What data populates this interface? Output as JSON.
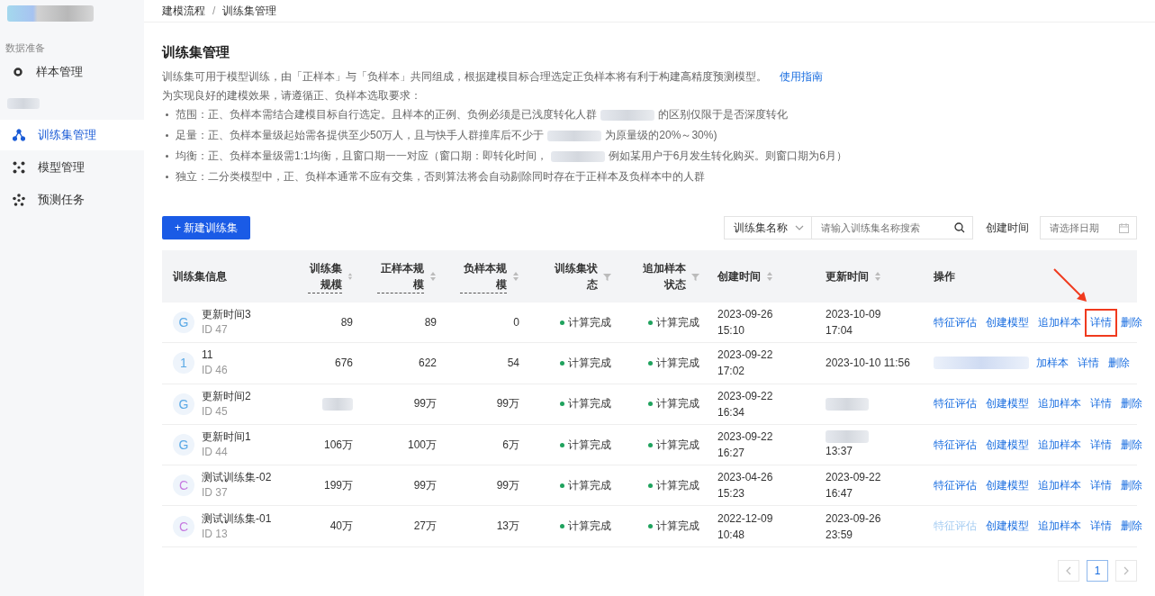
{
  "breadcrumb": {
    "separator": "/",
    "items": [
      "建模流程",
      "训练集管理"
    ]
  },
  "sidebar": {
    "section": "数据准备",
    "items": [
      {
        "label": "样本管理",
        "selected": false
      },
      {
        "kind": "blur"
      },
      {
        "label": "训练集管理",
        "selected": true
      },
      {
        "label": "模型管理",
        "selected": false
      },
      {
        "label": "预测任务",
        "selected": false
      }
    ]
  },
  "page": {
    "title": "训练集管理",
    "intro": "训练集可用于模型训练，由「正样本」与「负样本」共同组成，根据建模目标合理选定正负样本将有利于构建高精度预测模型。",
    "guide_link": "使用指南",
    "requirements_intro": "为实现良好的建模效果，请遵循正、负样本选取要求：",
    "rules": [
      {
        "parts": [
          "范围：正、负样本需结合建模目标自行选定。且样本的正例、负例必须是已浅度转化人群",
          "的区别仅限于是否深度转化"
        ]
      },
      {
        "parts": [
          "足量：正、负样本量级起始需各提供至少50万人，且与快手人群撞库后不少于",
          "为原量级的20%～30%)"
        ]
      },
      {
        "parts": [
          "均衡：正、负样本量级需1:1均衡，且窗口期一一对应（窗口期：即转化时间，",
          "例如某用户于6月发生转化购买。则窗口期为6月）"
        ]
      },
      {
        "parts": [
          "独立：二分类模型中，正、负样本通常不应有交集，否则算法将会自动剔除同时存在于正样本及负样本中的人群"
        ]
      }
    ]
  },
  "toolbar": {
    "create_button": "+ 新建训练集",
    "filter_select": "训练集名称",
    "search_placeholder": "请输入训练集名称搜索",
    "date_label": "创建时间",
    "date_placeholder": "请选择日期"
  },
  "table": {
    "columns": [
      {
        "label": "训练集信息",
        "tip": false
      },
      {
        "label": "训练集规模",
        "tip": true
      },
      {
        "label": "正样本规模",
        "tip": true
      },
      {
        "label": "负样本规模",
        "tip": true
      },
      {
        "label": "训练集状态",
        "tip": false
      },
      {
        "label": "追加样本状态",
        "tip": false
      },
      {
        "label": "创建时间",
        "tip": false
      },
      {
        "label": "更新时间",
        "tip": false
      },
      {
        "label": "操作",
        "tip": false
      }
    ],
    "rows": [
      {
        "avatar": "G",
        "color": "#5aa9e6",
        "name": "更新时间3",
        "id": "ID 47",
        "total": "89",
        "positive": "89",
        "negative": "0",
        "status": "计算完成",
        "append_status": "计算完成",
        "created": {
          "date": "2023-09-26",
          "time": "15:10"
        },
        "updated": {
          "date": "2023-10-09",
          "time": "17:04"
        },
        "actions": [
          {
            "label": "特征评估",
            "disabled": false,
            "highlighted": false
          },
          {
            "label": "创建模型",
            "disabled": false,
            "highlighted": false
          },
          {
            "label": "追加样本",
            "disabled": false,
            "highlighted": false
          },
          {
            "label": "详情",
            "disabled": false,
            "highlighted": true
          },
          {
            "label": "删除",
            "disabled": false,
            "highlighted": false
          }
        ]
      },
      {
        "avatar": "1",
        "color": "#5aa9e6",
        "name": "11",
        "id": "ID 46",
        "total": "676",
        "positive": "622",
        "negative": "54",
        "status": "计算完成",
        "append_status": "计算完成",
        "created": {
          "date": "2023-09-22",
          "time": "17:02"
        },
        "updated": {
          "date": "2023-10-10 11:56"
        },
        "actions": [
          {
            "kind": "blur"
          },
          {
            "label": "加样本",
            "disabled": false,
            "highlighted": false
          },
          {
            "label": "详情",
            "disabled": false,
            "highlighted": false
          },
          {
            "label": "删除",
            "disabled": false,
            "highlighted": false
          }
        ]
      },
      {
        "avatar": "G",
        "color": "#5aa9e6",
        "name": "更新时间2",
        "id": "ID 45",
        "positive": "99万",
        "negative": "99万",
        "status": "计算完成",
        "append_status": "计算完成",
        "created": {
          "date": "2023-09-22",
          "time": "16:34"
        },
        "actions": [
          {
            "label": "特征评估",
            "disabled": false,
            "highlighted": false
          },
          {
            "label": "创建模型",
            "disabled": false,
            "highlighted": false
          },
          {
            "label": "追加样本",
            "disabled": false,
            "highlighted": false
          },
          {
            "label": "详情",
            "disabled": false,
            "highlighted": false
          },
          {
            "label": "删除",
            "disabled": false,
            "highlighted": false
          }
        ]
      },
      {
        "avatar": "G",
        "color": "#5aa9e6",
        "name": "更新时间1",
        "id": "ID 44",
        "total": "106万",
        "positive": "100万",
        "negative": "6万",
        "status": "计算完成",
        "append_status": "计算完成",
        "created": {
          "date": "2023-09-22",
          "time": "16:27"
        },
        "updated": {
          "time": "13:37"
        },
        "actions": [
          {
            "label": "特征评估",
            "disabled": false,
            "highlighted": false
          },
          {
            "label": "创建模型",
            "disabled": false,
            "highlighted": false
          },
          {
            "label": "追加样本",
            "disabled": false,
            "highlighted": false
          },
          {
            "label": "详情",
            "disabled": false,
            "highlighted": false
          },
          {
            "label": "删除",
            "disabled": false,
            "highlighted": false
          }
        ]
      },
      {
        "avatar": "C",
        "color": "#c77be0",
        "name": "测试训练集-02",
        "id": "ID 37",
        "total": "199万",
        "positive": "99万",
        "negative": "99万",
        "status": "计算完成",
        "append_status": "计算完成",
        "created": {
          "date": "2023-04-26",
          "time": "15:23"
        },
        "updated": {
          "date": "2023-09-22",
          "time": "16:47"
        },
        "actions": [
          {
            "label": "特征评估",
            "disabled": false,
            "highlighted": false
          },
          {
            "label": "创建模型",
            "disabled": false,
            "highlighted": false
          },
          {
            "label": "追加样本",
            "disabled": false,
            "highlighted": false
          },
          {
            "label": "详情",
            "disabled": false,
            "highlighted": false
          },
          {
            "label": "删除",
            "disabled": false,
            "highlighted": false
          }
        ]
      },
      {
        "avatar": "C",
        "color": "#c77be0",
        "name": "测试训练集-01",
        "id": "ID 13",
        "total": "40万",
        "positive": "27万",
        "negative": "13万",
        "status": "计算完成",
        "append_status": "计算完成",
        "created": {
          "date": "2022-12-09",
          "time": "10:48"
        },
        "updated": {
          "date": "2023-09-26",
          "time": "23:59"
        },
        "actions": [
          {
            "label": "特征评估",
            "disabled": true,
            "highlighted": false
          },
          {
            "label": "创建模型",
            "disabled": false,
            "highlighted": false
          },
          {
            "label": "追加样本",
            "disabled": false,
            "highlighted": false
          },
          {
            "label": "详情",
            "disabled": false,
            "highlighted": false
          },
          {
            "label": "删除",
            "disabled": false,
            "highlighted": false
          }
        ]
      }
    ]
  },
  "pagination": {
    "pages": [
      {
        "label": "1",
        "selected": true
      }
    ]
  }
}
